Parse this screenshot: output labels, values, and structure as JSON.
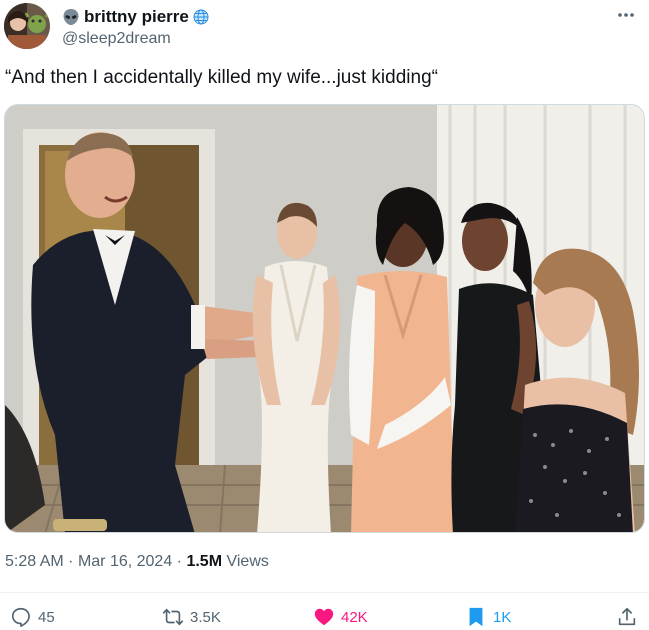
{
  "author": {
    "display_name": "brittny pierre",
    "handle": "@sleep2dream",
    "name_prefix_icon": "alien-icon",
    "name_suffix_icon": "globe-icon"
  },
  "tweet": {
    "text": "“And then I accidentally killed my wife...just kidding“"
  },
  "meta": {
    "time": "5:28 AM",
    "separator": "·",
    "date": "Mar 16, 2024",
    "views_count": "1.5M",
    "views_label": "Views"
  },
  "actions": {
    "replies": "45",
    "reposts": "3.5K",
    "likes": "42K",
    "bookmarks": "1K"
  },
  "colors": {
    "text": "#0f1419",
    "secondary": "#536471",
    "like": "#f91880",
    "bookmark": "#1d9bf0",
    "border": "#cfd9de"
  }
}
